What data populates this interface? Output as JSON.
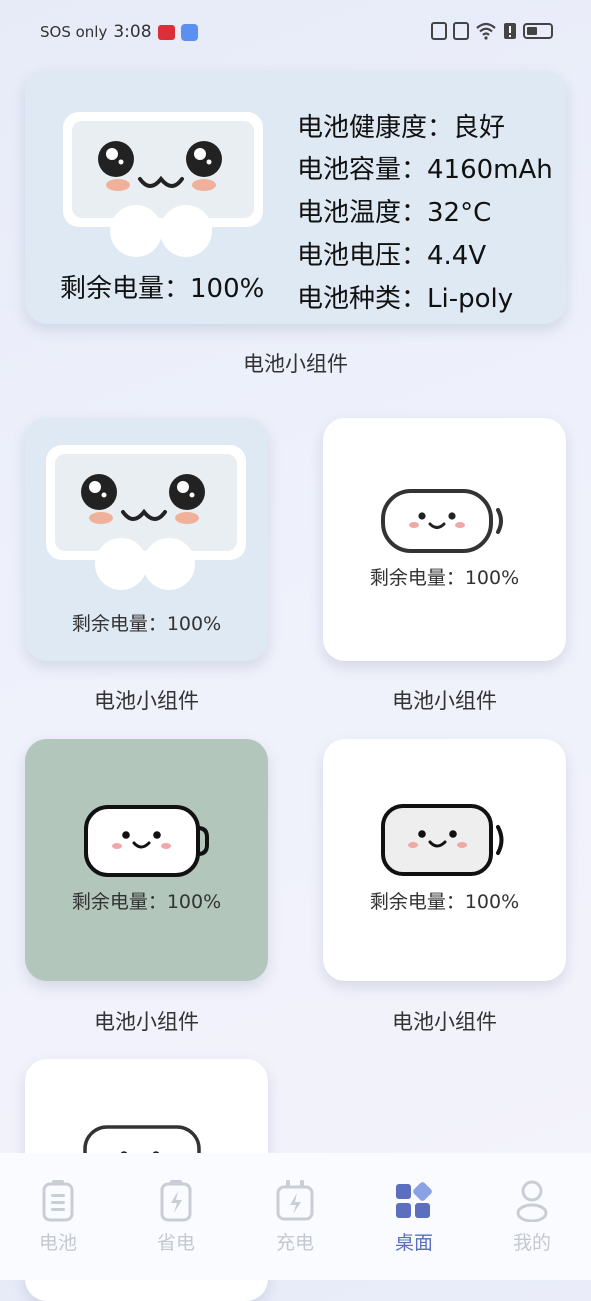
{
  "status_bar": {
    "carrier": "SOS only",
    "time": "3:08"
  },
  "main_widget": {
    "health_label": "电池健康度：良好",
    "capacity_label": "电池容量：4160mAh",
    "temperature_label": "电池温度：32°C",
    "voltage_label": "电池电压：4.4V",
    "type_label": "电池种类：Li-poly",
    "remaining_label": "剩余电量：100%",
    "caption": "电池小组件"
  },
  "widgets": [
    {
      "remaining_label": "剩余电量：100%",
      "caption": "电池小组件"
    },
    {
      "remaining_label": "剩余电量：100%",
      "caption": "电池小组件"
    },
    {
      "remaining_label": "剩余电量：100%",
      "caption": "电池小组件"
    },
    {
      "remaining_label": "剩余电量：100%",
      "caption": "电池小组件"
    }
  ],
  "nav": {
    "items": [
      {
        "label": "电池",
        "icon": "battery-icon"
      },
      {
        "label": "省电",
        "icon": "power-saving-icon"
      },
      {
        "label": "充电",
        "icon": "charging-icon"
      },
      {
        "label": "桌面",
        "icon": "desktop-icon",
        "active": true
      },
      {
        "label": "我的",
        "icon": "profile-icon"
      }
    ]
  },
  "colors": {
    "accent": "#5b6ebf",
    "card_light": "#dfe9f3",
    "card_green": "#b3c6bb",
    "nav_inactive": "#c4c8d0"
  }
}
